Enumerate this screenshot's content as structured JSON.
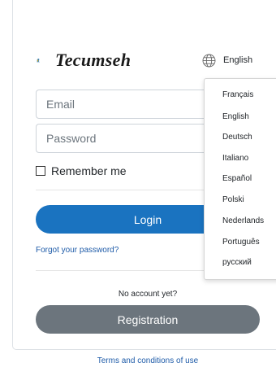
{
  "brand": {
    "logo_text": "Tecumseh"
  },
  "language": {
    "current": "English",
    "icon": "globe-icon",
    "options": [
      "Français",
      "English",
      "Deutsch",
      "Italiano",
      "Español",
      "Polski",
      "Nederlands",
      "Português",
      "русский"
    ]
  },
  "form": {
    "email_placeholder": "Email",
    "password_placeholder": "Password",
    "remember_label": "Remember me",
    "login_label": "Login",
    "forgot_label": "Forgot your password?"
  },
  "registration": {
    "prompt": "No account yet?",
    "button_label": "Registration"
  },
  "footer": {
    "terms_label": "Terms and conditions of use"
  },
  "colors": {
    "primary": "#1a73c0",
    "secondary": "#6c757d",
    "link": "#1e5ba8"
  }
}
